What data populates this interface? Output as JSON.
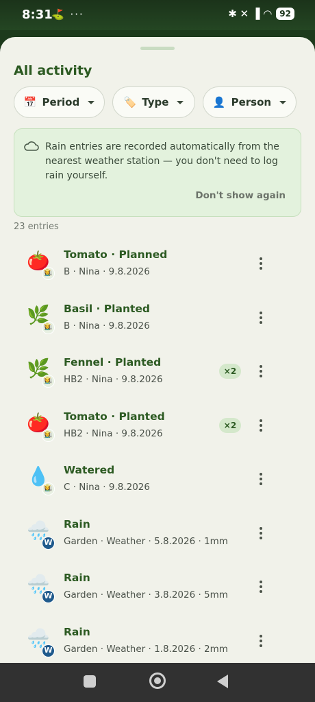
{
  "status_bar": {
    "time": "8:31",
    "left_icons": "⛳ ···",
    "right_icons": "✱ ✕ ▐ ◠",
    "battery": "92"
  },
  "sheet": {
    "title": "All activity",
    "filters": [
      {
        "emoji": "📅",
        "label": "Period"
      },
      {
        "emoji": "🏷️",
        "label": "Type"
      },
      {
        "emoji": "👤",
        "label": "Person"
      }
    ],
    "info": {
      "text": "Rain entries are recorded automatically from the nearest weather station — you don't need to log rain yourself.",
      "dismiss": "Don't show again"
    },
    "count": "23 entries",
    "entries": [
      {
        "icon": "🍅",
        "badge": "👩‍🌾",
        "name": "Tomato · Planned",
        "meta": "B · Nina · 9.8.2026",
        "multiplier": ""
      },
      {
        "icon": "🌿",
        "badge": "👩‍🌾",
        "name": "Basil · Planted",
        "meta": "B · Nina · 9.8.2026",
        "multiplier": ""
      },
      {
        "icon": "🌿",
        "badge": "👩‍🌾",
        "name": "Fennel · Planted",
        "meta": "HB2 · Nina · 9.8.2026",
        "multiplier": "×2"
      },
      {
        "icon": "🍅",
        "badge": "👩‍🌾",
        "name": "Tomato · Planted",
        "meta": "HB2 · Nina · 9.8.2026",
        "multiplier": "×2"
      },
      {
        "icon": "💧",
        "badge": "👩‍🌾",
        "name": "Watered",
        "meta": "C · Nina · 9.8.2026",
        "multiplier": ""
      },
      {
        "icon": "🌧️",
        "badge": "W",
        "name": "Rain",
        "meta": "Garden · Weather · 5.8.2026 · 1mm",
        "multiplier": ""
      },
      {
        "icon": "🌧️",
        "badge": "W",
        "name": "Rain",
        "meta": "Garden · Weather · 3.8.2026 · 5mm",
        "multiplier": ""
      },
      {
        "icon": "🌧️",
        "badge": "W",
        "name": "Rain",
        "meta": "Garden · Weather · 1.8.2026 · 2mm",
        "multiplier": ""
      }
    ]
  },
  "colors": {
    "accent": "#2c5a22",
    "info_bg": "#e3f2dd",
    "weather_badge": "#1f5a8c"
  }
}
